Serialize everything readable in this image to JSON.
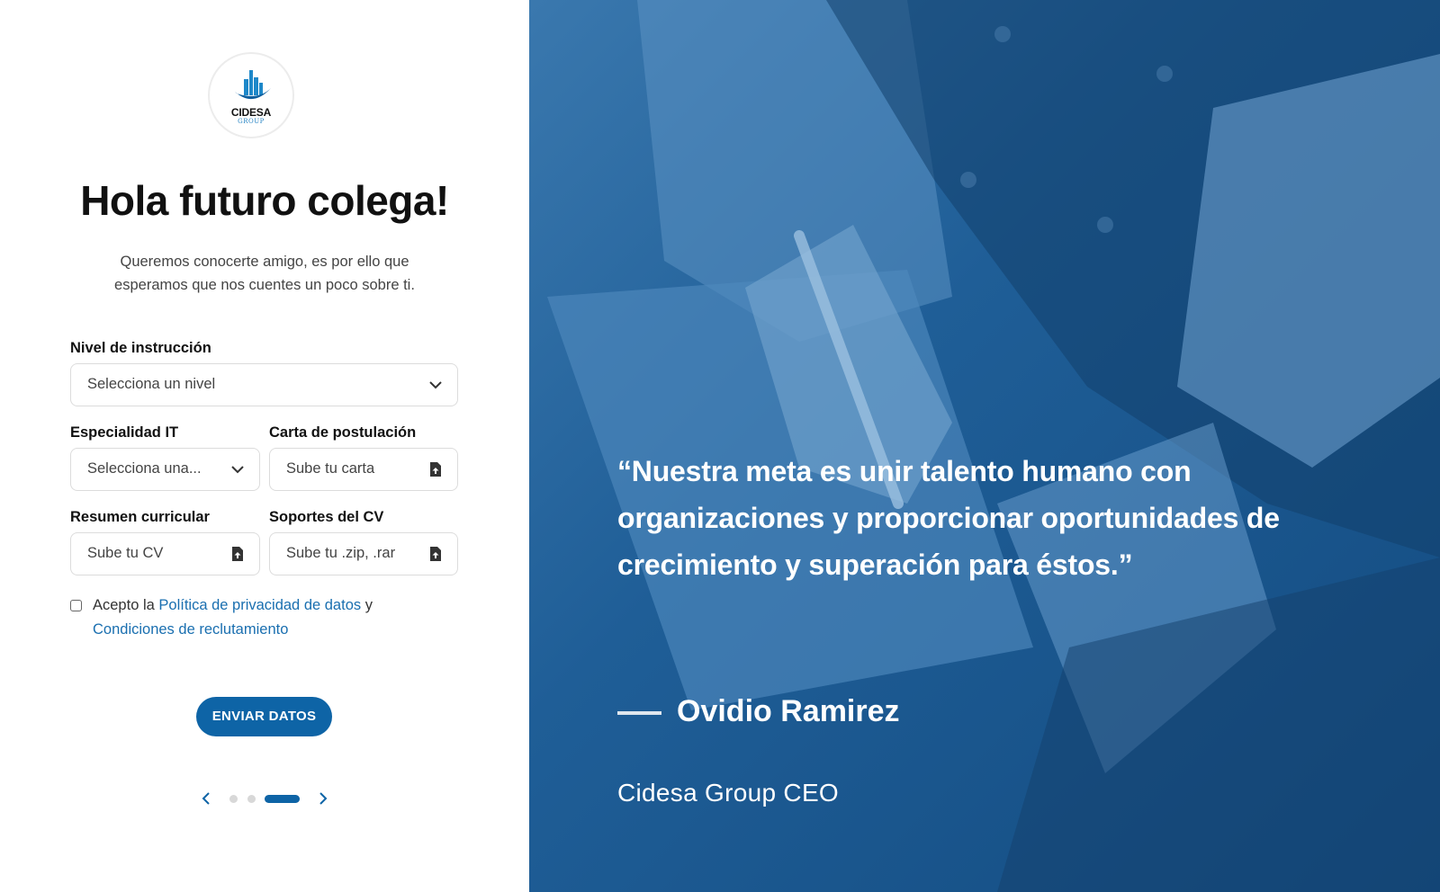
{
  "logo": {
    "brand": "CIDESA",
    "sub": "GROUP"
  },
  "heading": {
    "title": "Hola futuro colega!",
    "subtitle": "Queremos conocerte amigo, es por ello que esperamos que nos cuentes un poco sobre ti."
  },
  "form": {
    "nivel": {
      "label": "Nivel de instrucción",
      "value": "Selecciona un nivel"
    },
    "especialidad": {
      "label": "Especialidad IT",
      "value": "Selecciona una..."
    },
    "carta": {
      "label": "Carta de postulación",
      "value": "Sube tu carta"
    },
    "resumen": {
      "label": "Resumen curricular",
      "value": "Sube tu CV"
    },
    "soportes": {
      "label": "Soportes del CV",
      "value": "Sube tu .zip, .rar"
    },
    "consent": {
      "prefix": "Acepto la ",
      "link1": "Política de privacidad de datos",
      "middle": " y",
      "link2": "Condiciones de reclutamiento"
    },
    "submit": "ENVIAR DATOS"
  },
  "pager": {
    "total": 3,
    "active": 3
  },
  "testimonial": {
    "quote": "“Nuestra meta es unir talento humano con organizaciones y proporcionar oportunidades de crecimiento y superación para éstos.”",
    "author": "Ovidio Ramirez",
    "role": "Cidesa Group CEO"
  },
  "colors": {
    "primary": "#0e64a6",
    "link": "#1a6fb0",
    "overlay": "#1f5e97"
  },
  "icons": [
    "chevron-down-icon",
    "file-upload-icon",
    "chevron-left-icon",
    "chevron-right-icon",
    "company-logo"
  ]
}
